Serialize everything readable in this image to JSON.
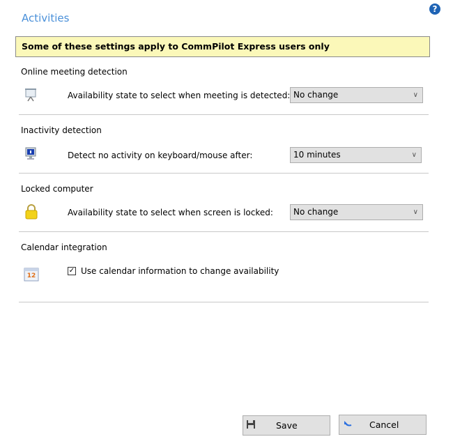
{
  "header": {
    "title": "Activities",
    "help_icon": "help-icon"
  },
  "banner": {
    "text": "Some of these settings apply to CommPilot Express users only"
  },
  "sections": [
    {
      "heading": "Online meeting detection",
      "icon": "presentation-board-icon",
      "label": "Availability state to select when meeting is detected:",
      "select_value": "No change"
    },
    {
      "heading": "Inactivity detection",
      "icon": "monitor-icon",
      "label": "Detect no activity on keyboard/mouse after:",
      "select_value": "10 minutes"
    },
    {
      "heading": "Locked computer",
      "icon": "padlock-icon",
      "label": "Availability state to select when screen is locked:",
      "select_value": "No change"
    },
    {
      "heading": "Calendar integration",
      "icon": "calendar-icon",
      "checkbox_label": "Use calendar information to change availability",
      "checkbox_checked": true,
      "calendar_day": "12"
    }
  ],
  "footer": {
    "save_label": "Save",
    "cancel_label": "Cancel"
  }
}
